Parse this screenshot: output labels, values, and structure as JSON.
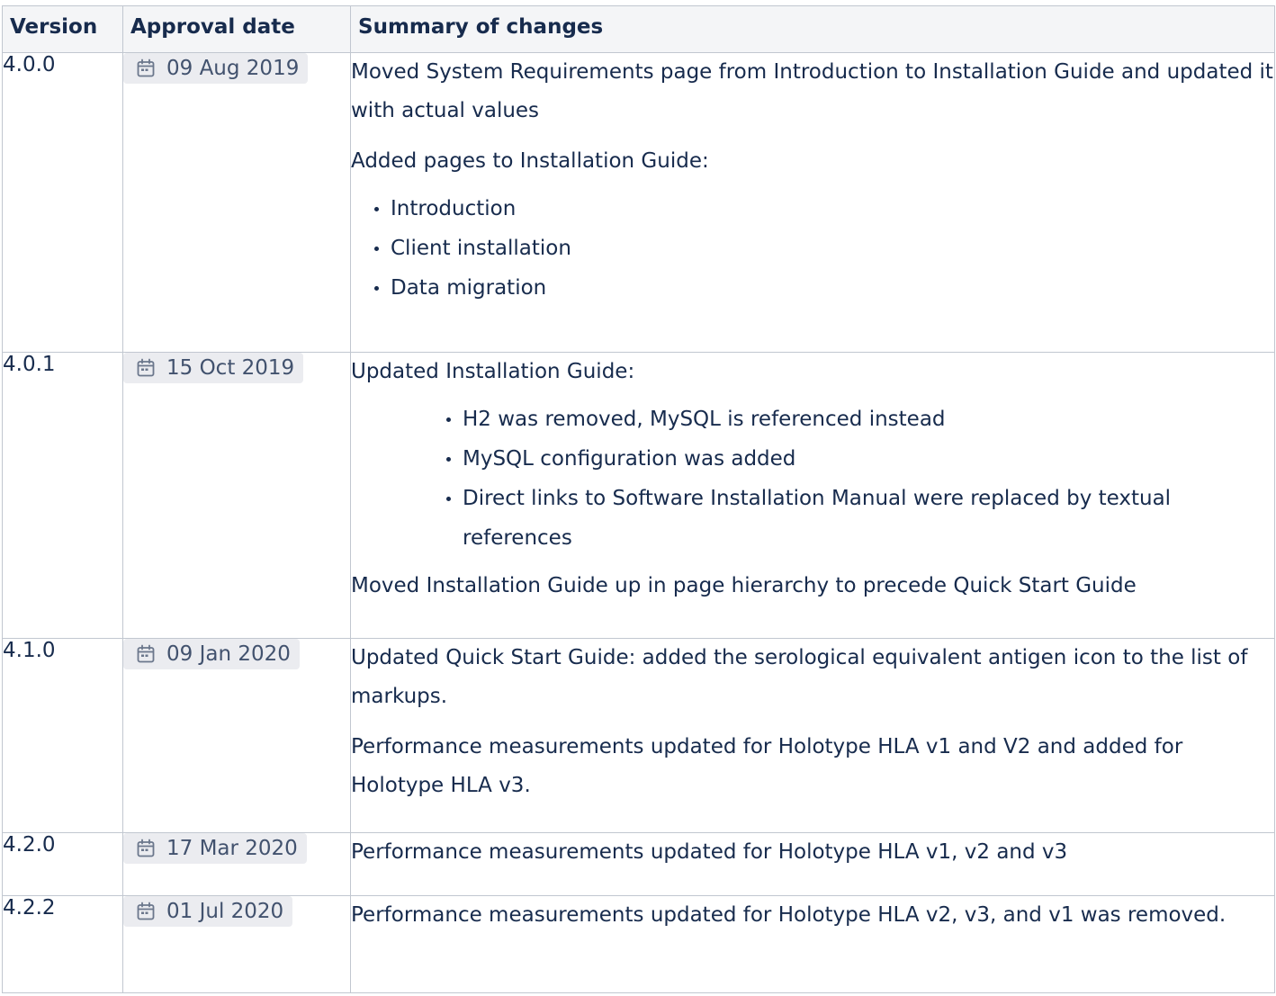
{
  "table": {
    "headers": {
      "version": "Version",
      "approval_date": "Approval date",
      "summary": "Summary of changes"
    },
    "rows": [
      {
        "version": "4.0.0",
        "date": "09 Aug 2019",
        "p1": "Moved System Requirements page from Introduction to Installation Guide and updated it with actual values",
        "p2": "Added pages to Installation Guide:",
        "items": [
          "Introduction",
          "Client installation",
          "Data migration"
        ]
      },
      {
        "version": "4.0.1",
        "date": "15 Oct 2019",
        "p1": "Updated Installation Guide:",
        "items": [
          "H2 was removed, MySQL is referenced instead",
          "MySQL configuration was added",
          "Direct links to Software Installation Manual were replaced by textual references"
        ],
        "p2": "Moved Installation Guide up in page hierarchy to precede Quick Start Guide"
      },
      {
        "version": "4.1.0",
        "date": "09 Jan 2020",
        "p1": "Updated Quick Start Guide: added the serological equivalent antigen icon to the list of markups.",
        "p2": "Performance measurements updated for Holotype HLA v1 and V2 and added for Holotype HLA v3."
      },
      {
        "version": "4.2.0",
        "date": "17 Mar 2020",
        "p1": "Performance measurements updated for Holotype HLA v1, v2 and v3"
      },
      {
        "version": "4.2.2",
        "date": "01 Jul 2020",
        "p1": "Performance measurements updated for Holotype HLA v2, v3, and v1 was removed."
      }
    ]
  },
  "icons": {
    "date_icon": "calendar-icon"
  }
}
